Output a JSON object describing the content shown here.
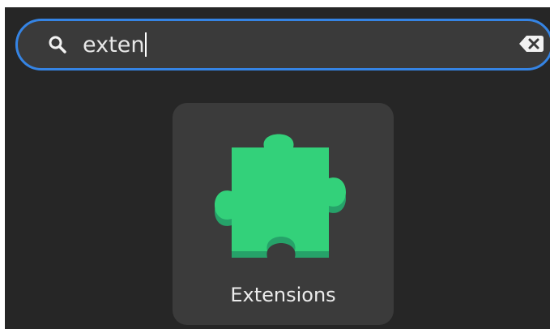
{
  "search": {
    "query": "exten",
    "icon": "search-icon",
    "clear_icon": "clear-text-icon",
    "accent_color": "#3584e4"
  },
  "results": [
    {
      "label": "Extensions",
      "icon": "puzzle-piece-icon",
      "icon_color": "#33d17a"
    }
  ],
  "colors": {
    "background": "#262626",
    "field": "#3a3a3a",
    "tile": "#3b3b3b",
    "text": "#ececec"
  }
}
